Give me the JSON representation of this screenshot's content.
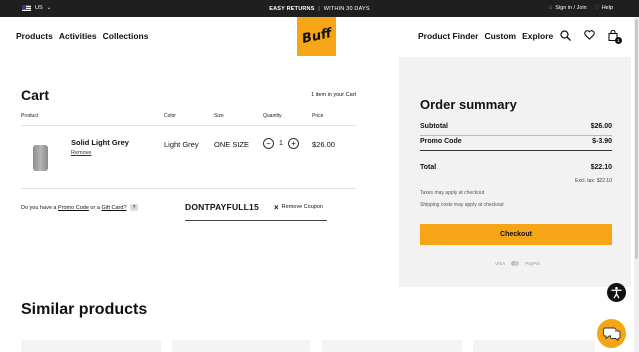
{
  "topbar": {
    "locale": "US",
    "promo_bold": "EASY RETURNS",
    "promo_sep": "|",
    "promo_rest": "WITHIN 30 DAYS",
    "sign_in": "Sign in / Join",
    "help": "Help"
  },
  "header": {
    "nav_left": [
      "Products",
      "Activities",
      "Collections"
    ],
    "logo_text": "Buff",
    "nav_right": [
      "Product Finder",
      "Custom",
      "Explore"
    ],
    "cart_badge": "1"
  },
  "cart": {
    "title": "Cart",
    "count_text": "1 item in your Cart",
    "columns": {
      "product": "Product",
      "color": "Color",
      "size": "Size",
      "quantity": "Quantity",
      "price": "Price"
    },
    "item": {
      "name": "Solid Light Grey",
      "remove": "Remove",
      "color": "Light Grey",
      "size": "ONE SIZE",
      "quantity": "1",
      "price": "$26.00"
    },
    "promo_prefix": "Do you have a ",
    "promo_link1": "Promo Code",
    "promo_mid": " or a ",
    "promo_link2": "Gift Card?",
    "promo_help": "?",
    "coupon_code": "DONTPAYFULL15",
    "remove_coupon": "Remove Coupon"
  },
  "summary": {
    "title": "Order summary",
    "subtotal_label": "Subtotal",
    "subtotal_value": "$26.00",
    "promo_label": "Promo Code",
    "promo_value": "$-3.90",
    "total_label": "Total",
    "total_value": "$22.10",
    "excl_tax": "Excl. tax: $22.10",
    "taxes_note": "Taxes may apply at checkout",
    "shipping_note": "Shipping costs may apply at checkout",
    "checkout": "Checkout",
    "payment_visa": "VISA",
    "payment_paypal": "PayPal"
  },
  "similar": {
    "title": "Similar products"
  },
  "colors": {
    "brand": "#f5a515",
    "topbar": "#1f1f1f",
    "summary_bg": "#f2f2f2"
  },
  "icons": [
    "us-flag-icon",
    "chevron-down-icon",
    "user-icon",
    "heart-icon",
    "search-icon",
    "wishlist-icon",
    "bag-icon",
    "accessibility-icon",
    "chat-icon",
    "minus-icon",
    "plus-icon",
    "close-icon"
  ]
}
